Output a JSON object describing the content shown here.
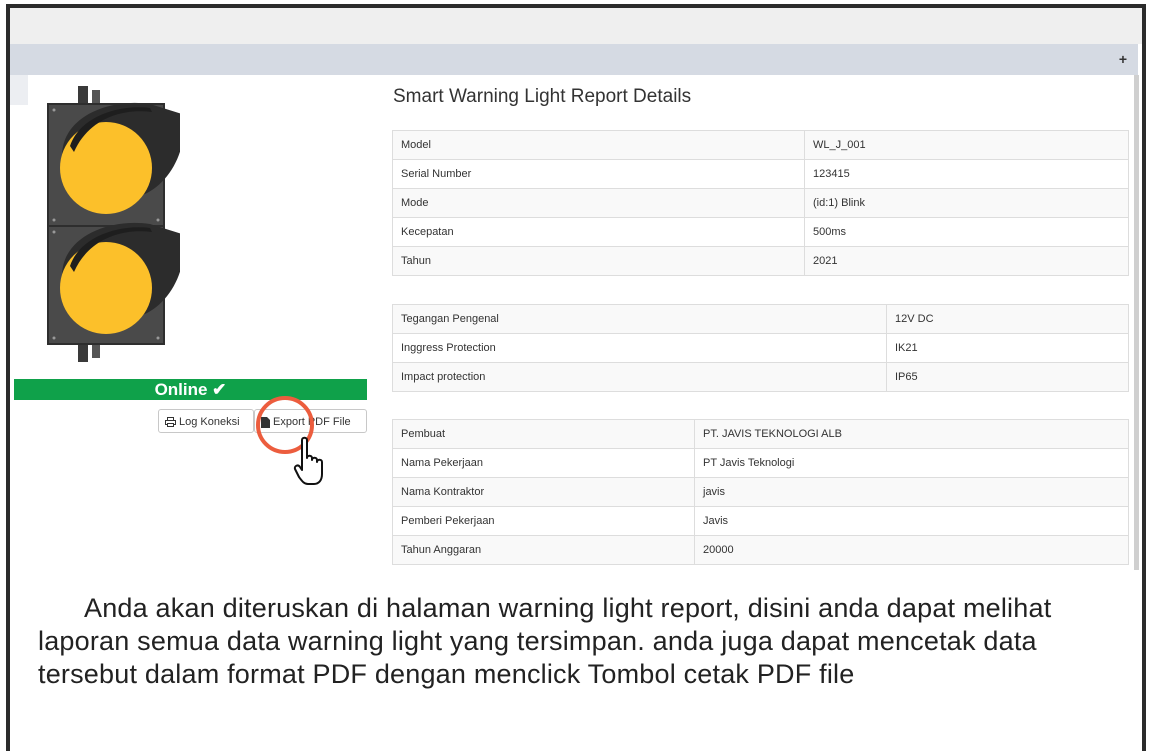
{
  "panel": {
    "expand_icon": "plus-icon",
    "expand_label": "+"
  },
  "device": {
    "image": "traffic-light-icon",
    "status_label": "Online ✔",
    "status_color": "#0fa14a"
  },
  "actions": {
    "log_label": "Log Koneksi",
    "log_icon": "print-icon",
    "pdf_label": "Export PDF File",
    "pdf_icon": "file-icon"
  },
  "report": {
    "title": "Smart Warning Light Report Details",
    "details": [
      {
        "key": "Model",
        "value": "WL_J_001"
      },
      {
        "key": "Serial Number",
        "value": "123415"
      },
      {
        "key": "Mode",
        "value": "(id:1) Blink"
      },
      {
        "key": "Kecepatan",
        "value": "500ms"
      },
      {
        "key": "Tahun",
        "value": "2021"
      }
    ],
    "specs": [
      {
        "key": "Tegangan Pengenal",
        "value": "12V DC"
      },
      {
        "key": "Inggress Protection",
        "value": "IK21"
      },
      {
        "key": "Impact protection",
        "value": "IP65"
      }
    ],
    "project": [
      {
        "key": "Pembuat",
        "value": "PT. JAVIS TEKNOLOGI ALB"
      },
      {
        "key": "Nama Pekerjaan",
        "value": "PT Javis Teknologi"
      },
      {
        "key": "Nama Kontraktor",
        "value": "javis"
      },
      {
        "key": "Pemberi Pekerjaan",
        "value": "Javis"
      },
      {
        "key": "Tahun Anggaran",
        "value": "20000"
      }
    ]
  },
  "caption": {
    "text": "Anda akan diteruskan di halaman warning light report, disini anda dapat melihat laporan semua data warning light yang tersimpan. anda juga dapat mencetak data tersebut dalam format PDF dengan menclick Tombol cetak PDF file"
  },
  "colors": {
    "highlight": "#ec5d3e",
    "header_band": "#d5dae3",
    "amber": "#fcc02a"
  }
}
